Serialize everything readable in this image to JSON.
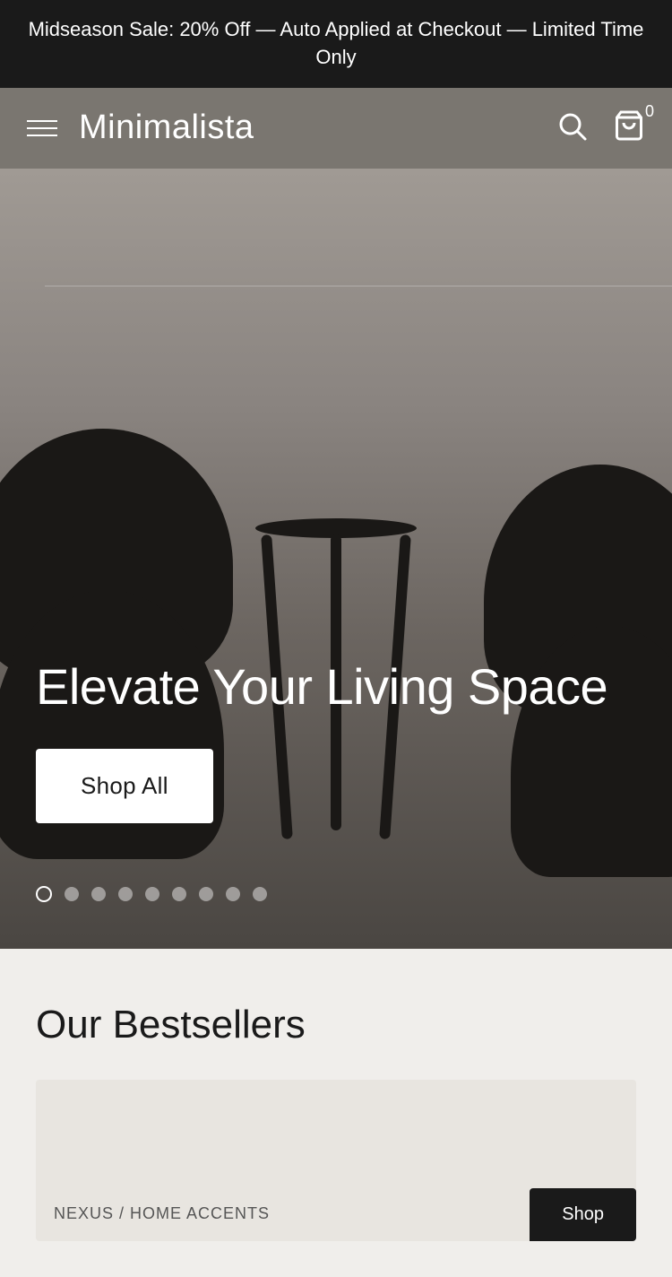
{
  "announcement": {
    "text": "Midseason Sale: 20% Off — Auto Applied at Checkout — Limited Time Only"
  },
  "header": {
    "brand": "Minimalista",
    "cart_count": "0"
  },
  "hero": {
    "headline": "Elevate Your Living Space",
    "shop_all_label": "Shop All",
    "dots_count": 9,
    "active_dot": 0
  },
  "bestsellers": {
    "title": "Our Bestsellers",
    "product_label": "NEXUS / HOME ACCENTS",
    "action_label": "Shop"
  },
  "icons": {
    "hamburger": "☰",
    "search": "search",
    "cart": "cart"
  }
}
